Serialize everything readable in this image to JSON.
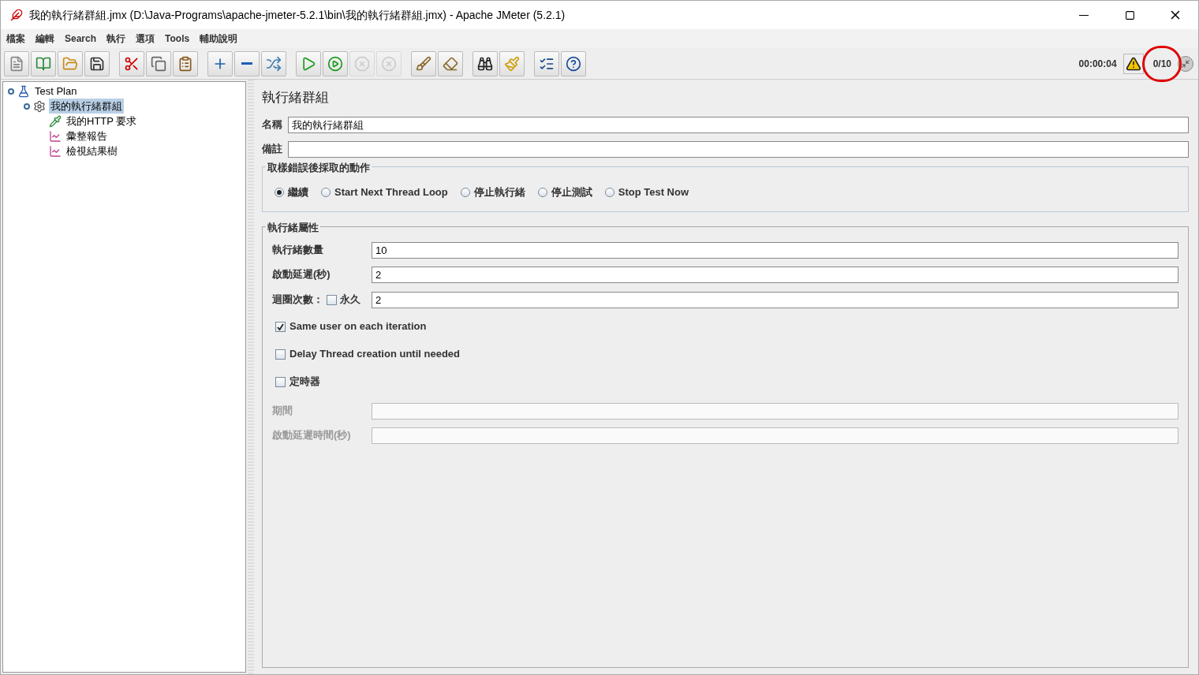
{
  "window": {
    "title": "我的執行緒群組.jmx (D:\\Java-Programs\\apache-jmeter-5.2.1\\bin\\我的執行緒群組.jmx) - Apache JMeter (5.2.1)"
  },
  "menu": [
    "檔案",
    "編輯",
    "Search",
    "執行",
    "選項",
    "Tools",
    "輔助說明"
  ],
  "toolbar": [
    {
      "kind": "new",
      "disabled": false
    },
    {
      "kind": "templates",
      "disabled": false
    },
    {
      "kind": "open",
      "disabled": false
    },
    {
      "kind": "save",
      "disabled": false
    },
    {
      "kind": "sep"
    },
    {
      "kind": "cut",
      "disabled": false
    },
    {
      "kind": "copy",
      "disabled": false
    },
    {
      "kind": "paste",
      "disabled": false
    },
    {
      "kind": "sep"
    },
    {
      "kind": "expand",
      "disabled": false
    },
    {
      "kind": "collapse",
      "disabled": false
    },
    {
      "kind": "toggle",
      "disabled": false
    },
    {
      "kind": "sep"
    },
    {
      "kind": "start",
      "disabled": false
    },
    {
      "kind": "start-no-pause",
      "disabled": false
    },
    {
      "kind": "stop",
      "disabled": true
    },
    {
      "kind": "shutdown",
      "disabled": true
    },
    {
      "kind": "sep"
    },
    {
      "kind": "clear",
      "disabled": false
    },
    {
      "kind": "clear-all",
      "disabled": false
    },
    {
      "kind": "sep"
    },
    {
      "kind": "search",
      "disabled": false
    },
    {
      "kind": "reset-search",
      "disabled": false
    },
    {
      "kind": "sep"
    },
    {
      "kind": "functions",
      "disabled": false
    },
    {
      "kind": "help",
      "disabled": false
    }
  ],
  "status": {
    "time": "00:00:04",
    "threads": "0/10"
  },
  "tree": [
    {
      "label": "Test Plan",
      "kind": "plan",
      "selected": false,
      "expanded": true,
      "children": [
        {
          "label": "我的執行緒群組",
          "kind": "thread-group",
          "selected": true,
          "expanded": true,
          "children": [
            {
              "label": "我的HTTP 要求",
              "kind": "sampler",
              "selected": false
            },
            {
              "label": "彙整報告",
              "kind": "listener",
              "selected": false
            },
            {
              "label": "檢視結果樹",
              "kind": "listener",
              "selected": false
            }
          ]
        }
      ]
    }
  ],
  "panel": {
    "title": "執行緒群組",
    "fields": [
      {
        "label": "名稱",
        "value": "我的執行緒群組"
      },
      {
        "label": "備註"
      }
    ],
    "error_action": {
      "title": "取樣錯誤後採取的動作",
      "options": [
        {
          "label": "繼續",
          "selected": true
        },
        {
          "label": "Start Next Thread Loop",
          "selected": false
        },
        {
          "label": "停止執行緒",
          "selected": false
        },
        {
          "label": "停止測試",
          "selected": false
        },
        {
          "label": "Stop Test Now",
          "selected": false
        }
      ]
    },
    "properties": {
      "title": "執行緒屬性",
      "threads": {
        "label": "執行緒數量",
        "value": "10"
      },
      "ramp_up": {
        "label": "啟動延遲(秒)",
        "value": "2"
      },
      "loop": {
        "label": "迴圈次數：",
        "forever_label": "永久",
        "forever": false,
        "value": "2"
      },
      "checkboxes": [
        {
          "label": "Same user on each iteration",
          "checked": true
        },
        {
          "label": "Delay Thread creation until needed",
          "checked": false
        },
        {
          "label": "定時器",
          "checked": false
        }
      ],
      "scheduler_fields": [
        {
          "label": "期間",
          "disabled": true
        },
        {
          "label": "啟動延遲時間(秒)",
          "disabled": true
        }
      ]
    }
  }
}
